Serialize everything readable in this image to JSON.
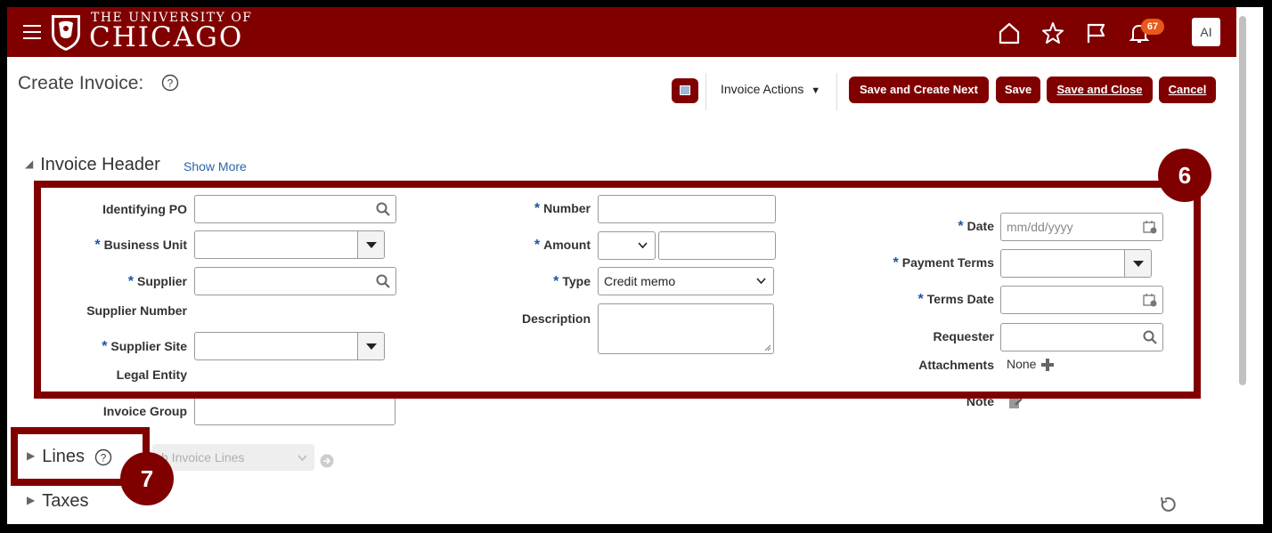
{
  "header": {
    "brand_line1": "THE UNIVERSITY OF",
    "brand_line2": "CHICAGO",
    "notifications_count": "67",
    "user_initials": "AI",
    "brand_color": "#800000"
  },
  "page": {
    "title": "Create Invoice:"
  },
  "toolbar": {
    "invoice_actions": "Invoice Actions",
    "save_create_next": "Save and Create Next",
    "save": "Save",
    "save_close": "Save and Close",
    "cancel": "Cancel"
  },
  "invoice_header": {
    "title": "Invoice Header",
    "show_more": "Show More",
    "col1": {
      "identifying_po": "Identifying PO",
      "business_unit": "Business Unit",
      "supplier": "Supplier",
      "supplier_number": "Supplier Number",
      "supplier_site": "Supplier Site",
      "legal_entity": "Legal Entity",
      "invoice_group": "Invoice Group"
    },
    "col2": {
      "number": "Number",
      "amount": "Amount",
      "type": "Type",
      "type_value": "Credit memo",
      "description": "Description"
    },
    "col3": {
      "date": "Date",
      "date_placeholder": "mm/dd/yyyy",
      "payment_terms": "Payment Terms",
      "terms_date": "Terms Date",
      "requester": "Requester",
      "attachments": "Attachments",
      "attachments_value": "None",
      "note": "Note"
    },
    "required_marker": "*"
  },
  "sections": {
    "lines": "Lines",
    "lines_select": "h Invoice Lines",
    "taxes": "Taxes"
  },
  "callouts": {
    "six": "6",
    "seven": "7"
  }
}
